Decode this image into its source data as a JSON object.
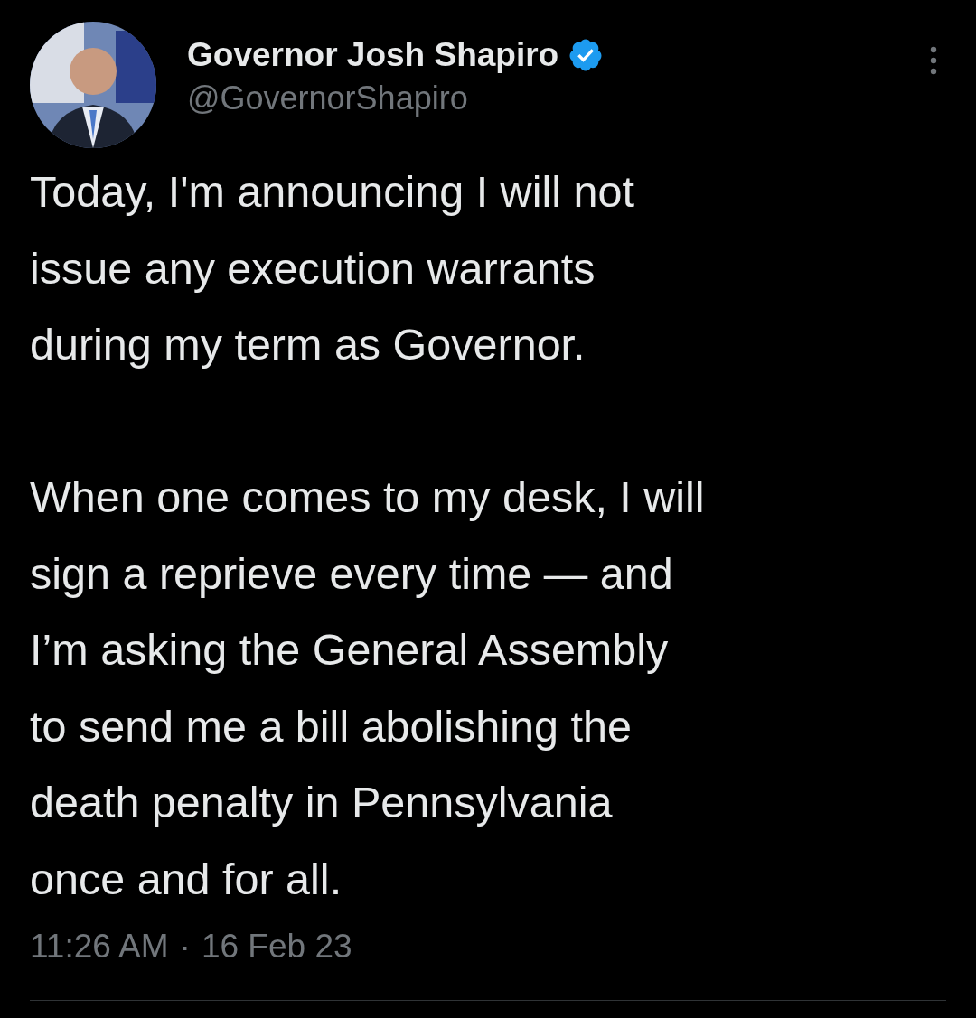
{
  "author": {
    "name": "Governor Josh Shapiro",
    "verified": true,
    "handle": "@GovernorShapiro"
  },
  "tweet": {
    "text": "Today, I'm announcing I will not\nissue any execution warrants\nduring my term as Governor.\n\nWhen one comes to my desk, I will\nsign a reprieve every time — and\nI’m asking the General Assembly\nto send me a bill abolishing the\ndeath penalty in Pennsylvania\nonce and for all.",
    "time": "11:26 AM",
    "separator": "·",
    "date": "16 Feb 23"
  }
}
